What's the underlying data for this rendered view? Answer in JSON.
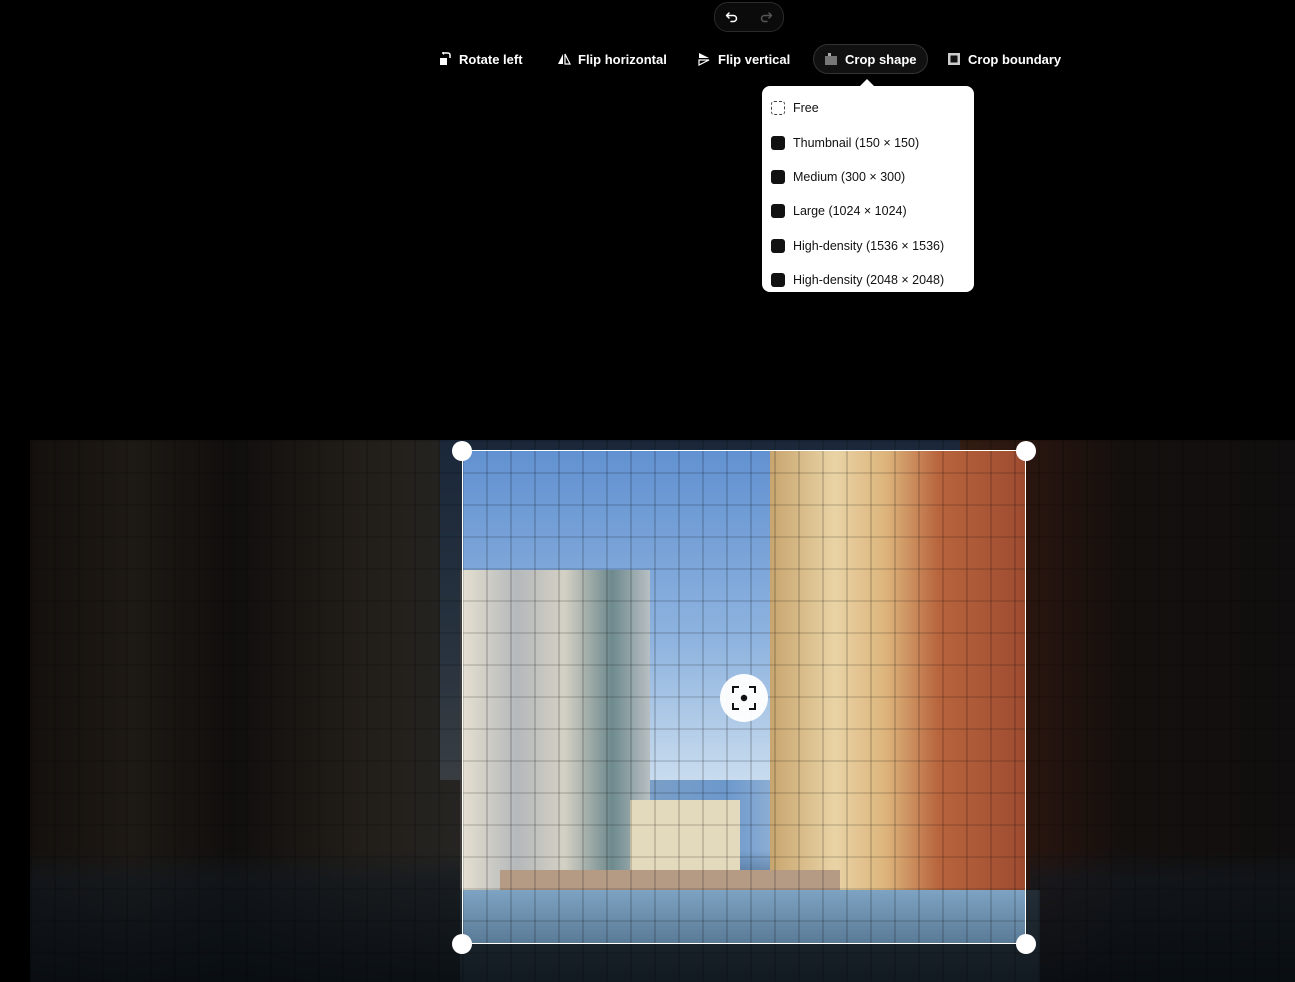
{
  "history": {
    "undo_icon": "undo-icon",
    "redo_icon": "redo-icon"
  },
  "toolbar": {
    "rotate_left": "Rotate left",
    "flip_horizontal": "Flip horizontal",
    "flip_vertical": "Flip vertical",
    "crop_shape": "Crop shape",
    "crop_boundary": "Crop boundary"
  },
  "crop_shape_menu": {
    "items": [
      {
        "label": "Free",
        "icon": "dashed-square-icon"
      },
      {
        "label": "Thumbnail (150 × 150)",
        "icon": "square-icon"
      },
      {
        "label": "Medium (300 × 300)",
        "icon": "square-icon"
      },
      {
        "label": "Large (1024 × 1024)",
        "icon": "square-icon"
      },
      {
        "label": "High-density (1536 × 1536)",
        "icon": "square-icon"
      },
      {
        "label": "High-density (2048 × 2048)",
        "icon": "square-icon"
      }
    ]
  },
  "editor": {
    "focal_point_icon": "focal-point-icon"
  }
}
